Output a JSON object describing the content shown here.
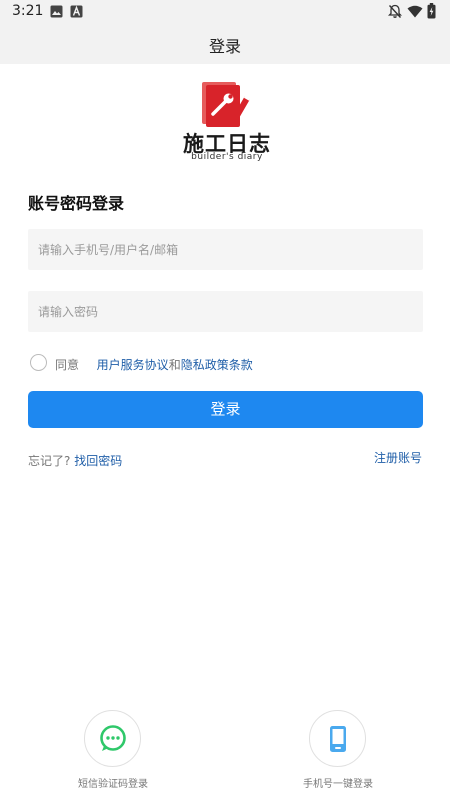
{
  "status_bar": {
    "time": "3:21"
  },
  "header": {
    "title": "登录"
  },
  "logo": {
    "name": "施工日志",
    "subtitle": "builder's diary"
  },
  "form": {
    "section_title": "账号密码登录",
    "username_placeholder": "请输入手机号/用户名/邮箱",
    "password_placeholder": "请输入密码",
    "agree_prefix": "同意",
    "user_agreement": "用户服务协议",
    "and": "和",
    "privacy_policy": "隐私政策条款",
    "login_button": "登录",
    "forgot_prefix": "忘记了?",
    "forgot_link": "找回密码",
    "register_link": "注册账号"
  },
  "alt_login": {
    "sms_label": "短信验证码登录",
    "phone_label": "手机号一键登录"
  },
  "colors": {
    "primary": "#1e88f0",
    "link": "#1f5ea8",
    "logo_red": "#d8232a",
    "sms_icon_green": "#2fc86a",
    "phone_icon_blue": "#4aa9ee"
  }
}
